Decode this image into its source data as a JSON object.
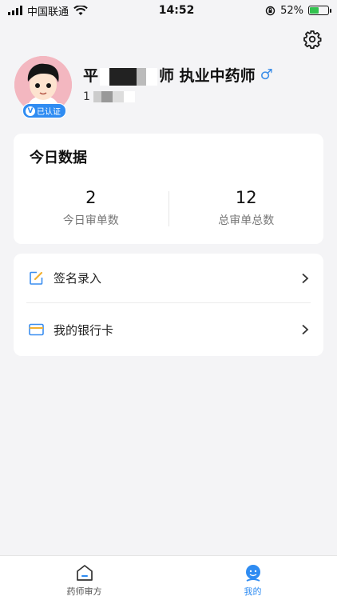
{
  "status_bar": {
    "carrier": "中国联通",
    "time": "14:52",
    "battery_percent": "52%",
    "battery_level": 0.52
  },
  "profile": {
    "name_prefix": "平",
    "name_suffix": "师 执业中药师",
    "gender_symbol": "♂",
    "verified_label": "已认证",
    "verified_mark": "V",
    "phone_prefix": "1"
  },
  "today": {
    "title": "今日数据",
    "stats": [
      {
        "value": "2",
        "label": "今日审单数"
      },
      {
        "value": "12",
        "label": "总审单总数"
      }
    ]
  },
  "menu": {
    "items": [
      {
        "label": "签名录入",
        "icon": "edit-icon"
      },
      {
        "label": "我的银行卡",
        "icon": "card-icon"
      }
    ]
  },
  "tab_bar": {
    "tabs": [
      {
        "label": "药师审方",
        "icon": "home-icon",
        "active": false
      },
      {
        "label": "我的",
        "icon": "profile-icon",
        "active": true
      }
    ]
  },
  "colors": {
    "accent": "#2f8cf2",
    "verified_badge": "#2f8cf2",
    "gender": "#3c8ee8",
    "edit_icon": "#f2b233"
  }
}
